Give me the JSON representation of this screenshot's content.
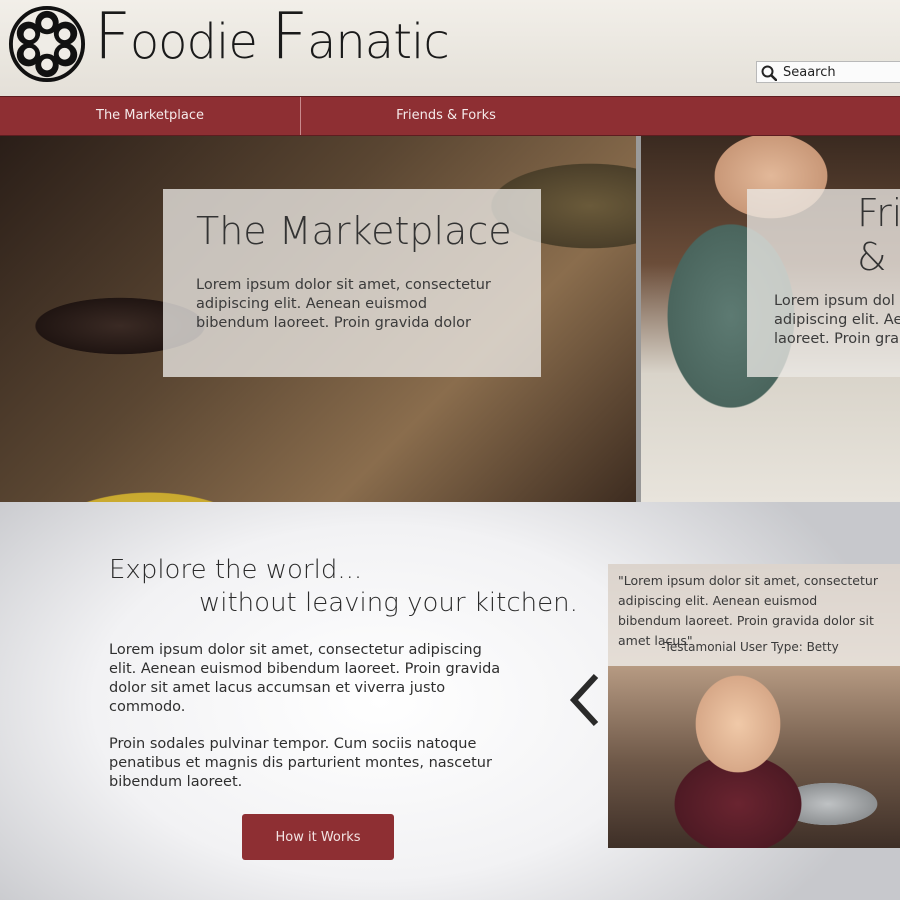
{
  "header": {
    "brand_part1_initial": "F",
    "brand_part1_rest": "oodie",
    "brand_part2_initial": "F",
    "brand_part2_rest": "anatic",
    "search_placeholder": "Seaarch",
    "logo_icon": "flower-icon",
    "search_icon": "magnifier-icon"
  },
  "nav": {
    "items": [
      {
        "label": "The Marketplace"
      },
      {
        "label": "Friends & Forks"
      }
    ]
  },
  "hero": {
    "left": {
      "title": "The Marketplace",
      "text": "Lorem ipsum dolor sit amet, consectetur adipiscing elit. Aenean euismod bibendum laoreet. Proin gravida dolor"
    },
    "right": {
      "title_line1": "Fri",
      "title_line2": "& F",
      "text": "Lorem ipsum dol adipiscing elit. Ae laoreet. Proin gra"
    }
  },
  "main": {
    "headline_line1": "Explore the world...",
    "headline_line2": "without leaving your kitchen.",
    "paragraph1": "Lorem ipsum dolor sit amet, consectetur adipiscing elit. Aenean euismod bibendum laoreet. Proin gravida dolor sit amet lacus accumsan et viverra justo commodo.",
    "paragraph2": "Proin sodales pulvinar tempor. Cum sociis natoque penatibus et magnis dis parturient montes, nascetur bibendum laoreet.",
    "cta_label": "How it Works",
    "prev_icon": "chevron-left-icon"
  },
  "testimonial": {
    "quote": "\"Lorem ipsum dolor sit amet, consectetur adipiscing elit. Aenean euismod bibendum laoreet. Proin gravida dolor sit amet lacus\"",
    "author": "-Testamonial User Type: Betty"
  },
  "colors": {
    "accent": "#8e2f33",
    "header_bg": "#ece8e1",
    "text": "#2b2b2b"
  }
}
